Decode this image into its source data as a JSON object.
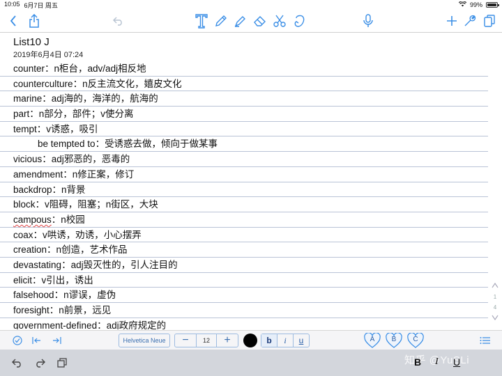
{
  "status_bar": {
    "time": "10:05",
    "date": "6月7日 周五",
    "battery": "99%",
    "battery_level": 0.99
  },
  "note": {
    "title": "List10 J",
    "date": "2019年6月4日 07:24",
    "lines": [
      {
        "word": "counter",
        "sep": "：",
        "def": "n柜台，adv/adj相反地"
      },
      {
        "word": "counterculture",
        "sep": "：",
        "def": "n反主流文化，嬉皮文化"
      },
      {
        "word": "marine",
        "sep": "：",
        "def": "adj海的，海洋的，航海的"
      },
      {
        "word": "part",
        "sep": "：",
        "def": "n部分，部件；v使分离"
      },
      {
        "word": "tempt",
        "sep": "：",
        "def": "v诱惑，吸引"
      },
      {
        "word": "be tempted to",
        "sep": "：",
        "def": "受诱惑去做，倾向于做某事",
        "indent": true
      },
      {
        "word": "vicious",
        "sep": "：",
        "def": "adj邪恶的，恶毒的"
      },
      {
        "word": "amendment",
        "sep": "：",
        "def": "n修正案，修订"
      },
      {
        "word": "backdrop",
        "sep": "：",
        "def": "n背景"
      },
      {
        "word": "block",
        "sep": "：",
        "def": "v阻碍，阻塞；n街区，大块"
      },
      {
        "word": "campous",
        "sep": "：",
        "def": "n校园"
      },
      {
        "word": "coax",
        "sep": "：",
        "def": "v哄诱，劝诱，小心摆弄"
      },
      {
        "word": "creation",
        "sep": "：",
        "def": "n创造，艺术作品"
      },
      {
        "word": "devastating",
        "sep": "：",
        "def": "adj毁灭性的，引人注目的"
      },
      {
        "word": "elicit",
        "sep": "：",
        "def": "v引出，诱出"
      },
      {
        "word": "falsehood",
        "sep": "：",
        "def": "n谬误，虚伪"
      },
      {
        "word": "foresight",
        "sep": "：",
        "def": "n前景，远见"
      },
      {
        "word": "government-defined",
        "sep": "：",
        "def": "adj政府规定的"
      }
    ]
  },
  "format_bar": {
    "font_name": "Helvetica Neue",
    "minus": "−",
    "font_size": "12",
    "plus": "+",
    "bold": "b",
    "italic": "i",
    "underline": "u",
    "style_a": "A",
    "style_b": "B",
    "style_c": "C",
    "text_color": "#000000"
  },
  "scroll_indicator": {
    "top": "1",
    "bottom": "4"
  },
  "keyboard_bar": {
    "bold": "B",
    "italic": "I",
    "underline": "U"
  },
  "watermark": "知乎 @YuSLi",
  "colors": {
    "accent": "#3a8ee6",
    "rule_line": "#b9c3d6"
  }
}
